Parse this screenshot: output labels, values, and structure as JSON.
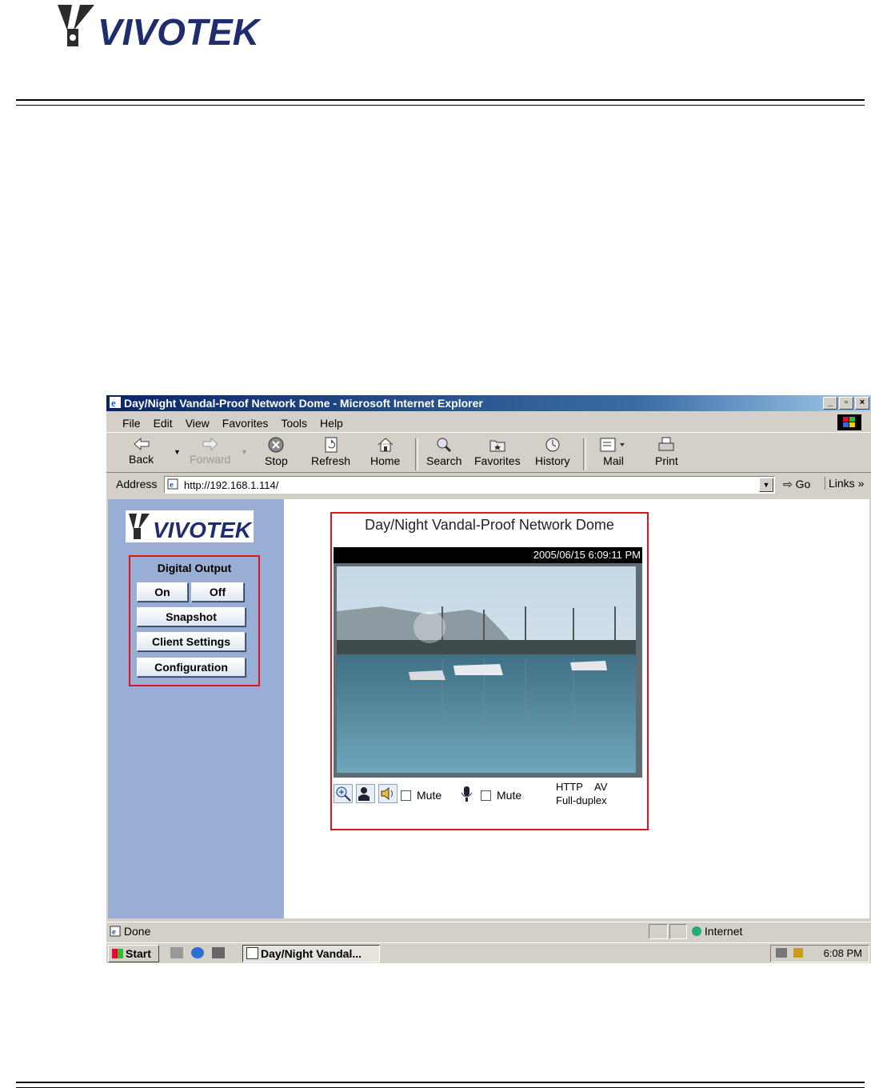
{
  "document": {
    "logo_text": "VIVOTEK"
  },
  "window": {
    "title": "Day/Night Vandal-Proof Network Dome - Microsoft Internet Explorer",
    "buttons": [
      "_",
      "▫",
      "×"
    ]
  },
  "menu": {
    "items": [
      "File",
      "Edit",
      "View",
      "Favorites",
      "Tools",
      "Help"
    ]
  },
  "toolbar": {
    "back": "Back",
    "forward": "Forward",
    "stop": "Stop",
    "refresh": "Refresh",
    "home": "Home",
    "search": "Search",
    "favorites": "Favorites",
    "history": "History",
    "mail": "Mail",
    "print": "Print"
  },
  "address": {
    "label": "Address",
    "url": "http://192.168.1.114/",
    "go": "Go",
    "links": "Links"
  },
  "sidebar": {
    "logo_text": "VIVOTEK",
    "digital_output_title": "Digital Output",
    "on": "On",
    "off": "Off",
    "snapshot": "Snapshot",
    "client_settings": "Client Settings",
    "configuration": "Configuration"
  },
  "camera": {
    "title": "Day/Night Vandal-Proof Network Dome",
    "timestamp": "2005/06/15 6:09:11 PM",
    "mute1": "Mute",
    "mute2": "Mute",
    "protocol": "HTTP",
    "av": "AV",
    "duplex": "Full-duplex"
  },
  "status": {
    "text": "Done",
    "zone": "Internet"
  },
  "taskbar": {
    "start": "Start",
    "task": "Day/Night Vandal...",
    "clock": "6:08 PM"
  },
  "colors": {
    "highlight_border": "#e0121b",
    "sidebar_bg": "#99aed4",
    "titlebar": "#0a246a"
  }
}
